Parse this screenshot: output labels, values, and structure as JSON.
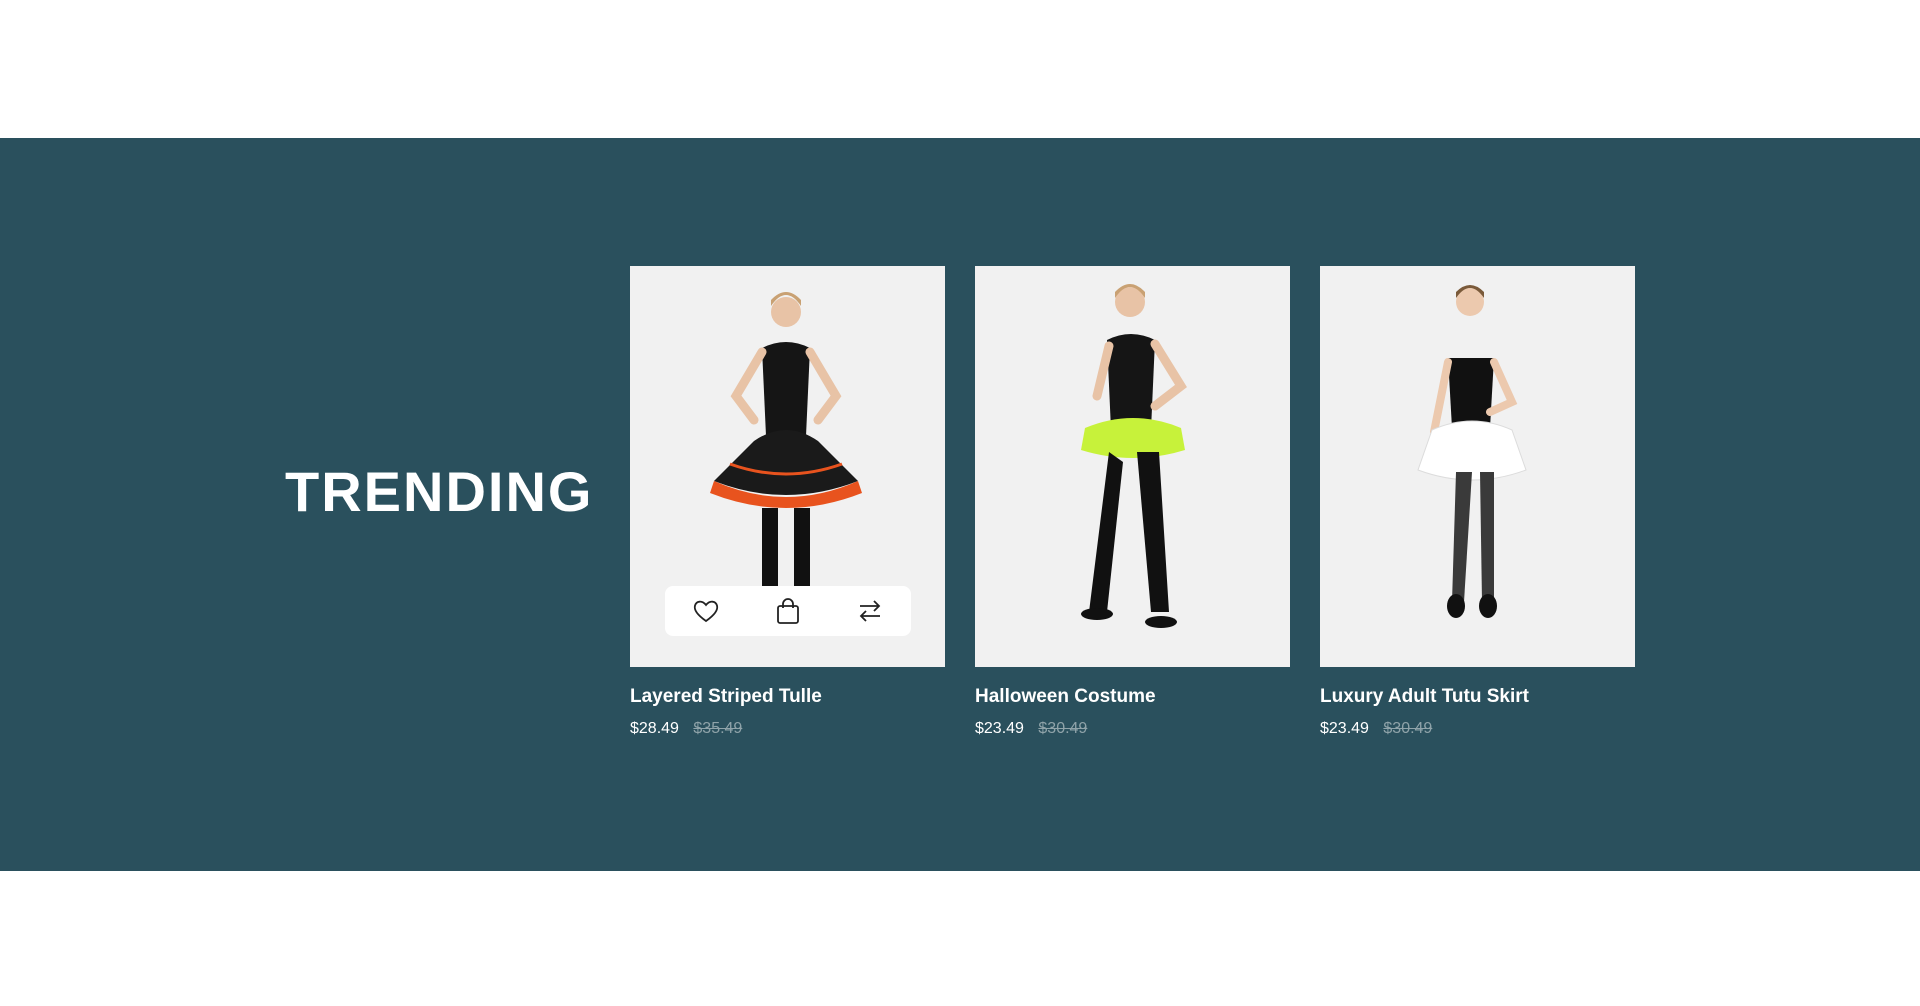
{
  "section": {
    "heading": "TRENDING"
  },
  "products": [
    {
      "title": "Layered Striped Tulle",
      "price": "$28.49",
      "old_price": "$35.49",
      "skirt_color": "#e8531e",
      "actions": [
        "heart-icon",
        "bag-icon",
        "compare-icon"
      ]
    },
    {
      "title": "Halloween Costume",
      "price": "$23.49",
      "old_price": "$30.49",
      "skirt_color": "#c7f23a"
    },
    {
      "title": "Luxury Adult Tutu Skirt",
      "price": "$23.49",
      "old_price": "$30.49",
      "skirt_color": "#ffffff"
    }
  ],
  "colors": {
    "band": "#2a505d",
    "card_bg": "#f1f1f1"
  }
}
